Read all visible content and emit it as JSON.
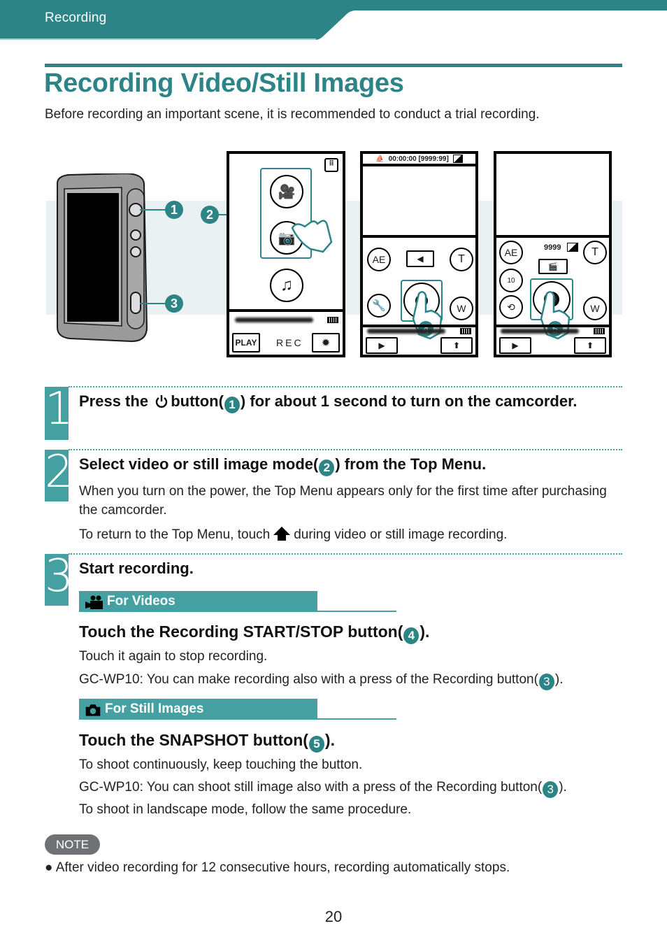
{
  "header": {
    "section_label": "Recording",
    "accent_color": "#2c8487"
  },
  "title": "Recording Video/Still Images",
  "intro": "Before recording an important scene, it is recommended to conduct a trial recording.",
  "illustration": {
    "callouts": [
      "1",
      "2",
      "3",
      "4",
      "5"
    ],
    "top_menu_screen": {
      "play_label": "PLAY",
      "rec_label": "REC",
      "icons": [
        "grid-menu-icon",
        "video-mode-icon",
        "still-mode-icon",
        "music-icon",
        "gear-icon"
      ]
    },
    "video_screen": {
      "status": "00:00:00 [9999:99]",
      "buttons": [
        "AE",
        "T",
        "W"
      ]
    },
    "still_screen": {
      "shots_remaining": "9999",
      "buttons": [
        "AE",
        "T",
        "W"
      ],
      "self_timer_label": "10"
    }
  },
  "steps": [
    {
      "number": "1",
      "title_pre": "Press the",
      "title_mid": "button(",
      "callout": "1",
      "title_post": ") for about 1 second to turn on the camcorder."
    },
    {
      "number": "2",
      "title_pre": "Select video or still image mode(",
      "callout": "2",
      "title_post": ") from the Top Menu.",
      "body": [
        "When you turn on the power, the Top Menu appears only for the first time after purchasing the camcorder."
      ],
      "return_pre": "To return to the Top Menu, touch",
      "return_post": "during video or still image recording."
    },
    {
      "number": "3",
      "title": "Start recording.",
      "videos": {
        "heading": "For Videos",
        "instruction_pre": "Touch the Recording START/STOP button(",
        "callout": "4",
        "instruction_post": ").",
        "line1": "Touch it again to stop recording.",
        "line2_pre": "GC-WP10: You can make recording also with a press of the Recording button(",
        "line2_callout": "3",
        "line2_post": ")."
      },
      "stills": {
        "heading": "For Still Images",
        "instruction_pre": "Touch the SNAPSHOT button(",
        "callout": "5",
        "instruction_post": ").",
        "line1": "To shoot continuously, keep touching the button.",
        "line2_pre": "GC-WP10: You can shoot still image also with a press of the Recording button(",
        "line2_callout": "3",
        "line2_post": ").",
        "line3": "To shoot in landscape mode, follow the same procedure."
      }
    }
  ],
  "note": {
    "badge": "NOTE",
    "items": [
      "After video recording for 12 consecutive hours, recording automatically stops."
    ]
  },
  "page_number": "20"
}
